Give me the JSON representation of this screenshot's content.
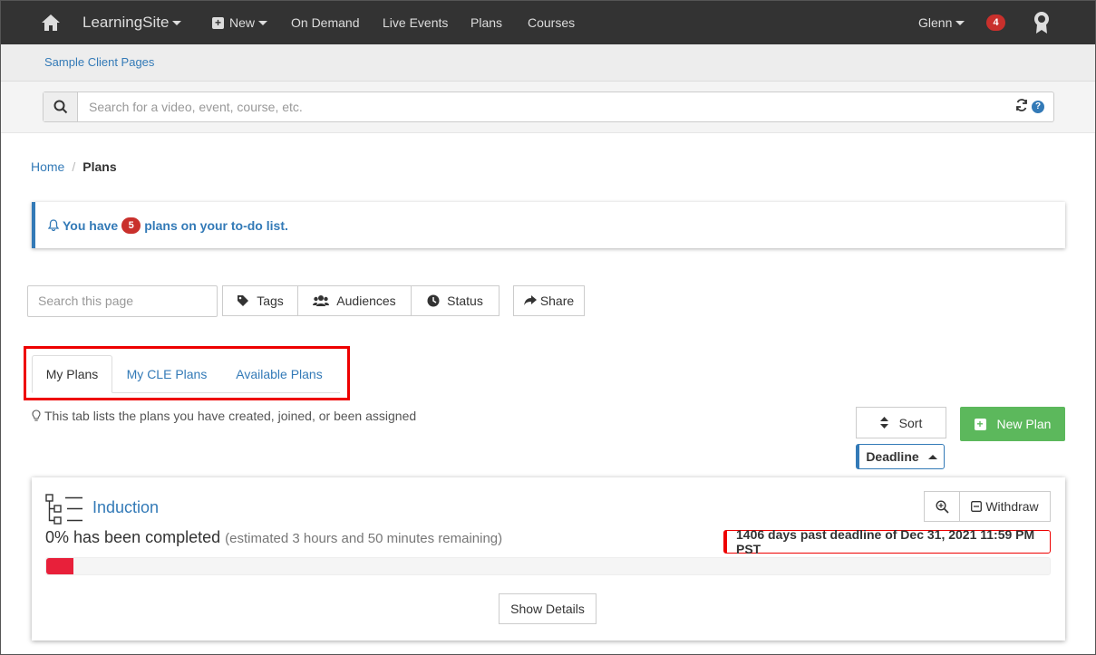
{
  "nav": {
    "brand": "LearningSite",
    "new_label": "New",
    "links": [
      "On Demand",
      "Live Events",
      "Plans",
      "Courses"
    ],
    "user": "Glenn",
    "notifications": "4"
  },
  "subbar": {
    "link": "Sample Client Pages"
  },
  "search": {
    "placeholder": "Search for a video, event, course, etc."
  },
  "breadcrumb": {
    "home": "Home",
    "current": "Plans"
  },
  "alert": {
    "prefix": "You have",
    "count": "5",
    "suffix": "plans on your to-do list."
  },
  "filters": {
    "search_placeholder": "Search this page",
    "tags": "Tags",
    "audiences": "Audiences",
    "status": "Status",
    "share": "Share"
  },
  "tabs": [
    {
      "label": "My Plans",
      "active": true
    },
    {
      "label": "My CLE Plans",
      "active": false
    },
    {
      "label": "Available Plans",
      "active": false
    }
  ],
  "tab_hint": "This tab lists the plans you have created, joined, or been assigned",
  "sort": {
    "label": "Sort",
    "selected": "Deadline"
  },
  "new_plan": "New Plan",
  "plan": {
    "title": "Induction",
    "progress_label": "0% has been completed",
    "estimate": "(estimated 3 hours and 50 minutes remaining)",
    "progress_value": 0,
    "deadline_note": "1406 days past deadline of Dec 31, 2021 11:59 PM PST",
    "withdraw": "Withdraw",
    "show_details": "Show Details"
  },
  "colors": {
    "accent": "#337ab7",
    "danger": "#e8203a",
    "success": "#5cb85c",
    "nav_bg": "#333333"
  }
}
